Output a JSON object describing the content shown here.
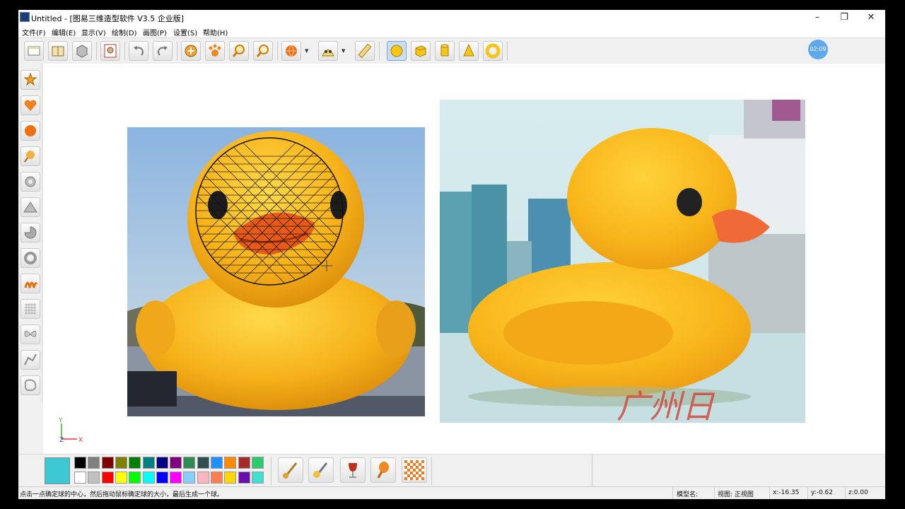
{
  "window": {
    "title": "Untitled - [图易三维造型软件 V3.5 企业版]",
    "minimize": "–",
    "maximize": "❐",
    "close": "✕"
  },
  "menu": [
    "文件(F)",
    "编辑(E)",
    "显示(V)",
    "绘制(D)",
    "画图(P)",
    "设置(S)",
    "帮助(H)"
  ],
  "toolbar": {
    "icons": [
      "new-icon",
      "open-icon",
      "save-icon",
      "print-icon",
      "undo-icon",
      "redo-icon",
      "rotate-icon",
      "pan-icon",
      "zoom-in-icon",
      "zoom-out-icon",
      "material-icon",
      "render-icon",
      "ruler-icon",
      "sphere-icon",
      "cube-icon",
      "cylinder-icon",
      "cone-icon",
      "torus-icon"
    ],
    "active": "sphere-icon"
  },
  "timer": "02:09",
  "left_tools": [
    "star-icon",
    "heart-icon",
    "sphere-tool-icon",
    "lathe-icon",
    "gear-icon",
    "mountain-icon",
    "pie-icon",
    "ring-icon",
    "spring-icon",
    "grid-icon",
    "butterfly-icon",
    "path-icon",
    "blob-icon"
  ],
  "axis": {
    "y": "Y",
    "z": "Z",
    "x": "X"
  },
  "watermark": "广州日",
  "palette": {
    "current": "#3cc8d2",
    "row1": [
      "#000000",
      "#808080",
      "#800000",
      "#808000",
      "#008000",
      "#008080",
      "#000080",
      "#800080",
      "#2e8b57",
      "#2f4f4f",
      "#1e90ff",
      "#ff8c00",
      "#a52a2a",
      "#2ecc71"
    ],
    "row2": [
      "#ffffff",
      "#c0c0c0",
      "#ff0000",
      "#ffff00",
      "#00ff00",
      "#00ffff",
      "#0000ff",
      "#ff00ff",
      "#87cefa",
      "#ffb6c1",
      "#ff7f50",
      "#ffd700",
      "#6a0dad",
      "#40e0d0"
    ],
    "tools": [
      "brush-icon",
      "paint-tool-icon",
      "glass-icon",
      "spray-icon",
      "texture-icon"
    ]
  },
  "status": {
    "hint": "点击一点确定球的中心，然后拖动鼠标确定球的大小，最后生成一个球。",
    "model_name": "模型名:",
    "view": "视图: 正视图",
    "x": "x:-16.35",
    "y": "y:-0.62",
    "z": "z:0.00"
  }
}
